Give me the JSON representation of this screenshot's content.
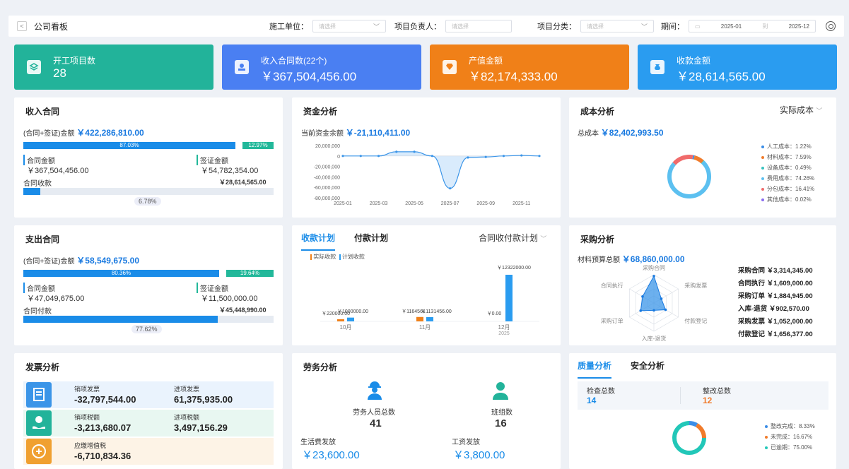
{
  "header": {
    "title": "公司看板",
    "back": "<",
    "filters": [
      {
        "label": "施工单位：",
        "placeholder": "请选择"
      },
      {
        "label": "项目负责人：",
        "placeholder": "请选择"
      },
      {
        "label": "项目分类：",
        "placeholder": "请选择"
      }
    ],
    "period": {
      "label": "期间：",
      "from": "2025-01",
      "sep": "到",
      "to": "2025-12"
    }
  },
  "kpis": [
    {
      "label": "开工项目数",
      "value": "28",
      "color": "#22b39a"
    },
    {
      "label": "收入合同数(22个)",
      "value": "￥367,504,456.00",
      "color": "#4a7ff2"
    },
    {
      "label": "产值金额",
      "value": "￥82,174,333.00",
      "color": "#f08018"
    },
    {
      "label": "收款金额",
      "value": "￥28,614,565.00",
      "color": "#2a9cf0"
    }
  ],
  "income": {
    "title": "收入合同",
    "total_label": "(合同+签证)金额",
    "total": "￥422,286,810.00",
    "bar_pct_a": "87.03%",
    "bar_pct_b": "12.97%",
    "frac_a": 0.8703,
    "contract_label": "合同金额",
    "contract": "￥367,504,456.00",
    "visa_label": "签证金额",
    "visa": "￥54,782,354.00",
    "recv_label": "合同收款",
    "recv": "￥28,614,565.00",
    "recv_pct": "6.78%",
    "recv_frac": 0.0678
  },
  "expense": {
    "title": "支出合同",
    "total_label": "(合同+签证)金额",
    "total": "￥58,549,675.00",
    "bar_pct_a": "80.36%",
    "bar_pct_b": "19.64%",
    "frac_a": 0.8036,
    "contract_label": "合同金额",
    "contract": "￥47,049,675.00",
    "visa_label": "签证金额",
    "visa": "￥11,500,000.00",
    "pay_label": "合同付款",
    "pay": "￥45,448,990.00",
    "pay_pct": "77.62%",
    "pay_frac": 0.7762
  },
  "funds": {
    "title": "资金分析",
    "balance_label": "当前资金余额",
    "balance": "￥-21,110,411.00"
  },
  "chart_data": [
    {
      "type": "area",
      "title": "资金分析",
      "x": [
        "2025-01",
        "2025-02",
        "2025-03",
        "2025-04",
        "2025-05",
        "2025-06",
        "2025-07",
        "2025-08",
        "2025-09",
        "2025-10",
        "2025-11",
        "2025-12"
      ],
      "ticks_x": [
        "2025-01",
        "2025-03",
        "2025-05",
        "2025-07",
        "2025-09",
        "2025-11"
      ],
      "values": [
        0,
        0,
        0,
        8000000,
        8000000,
        0,
        -62000000,
        -3000000,
        -2000000,
        0,
        1000000,
        0
      ],
      "ylim": [
        -80000000,
        20000000
      ],
      "ticks_y": [
        "20,000,000",
        "0",
        "-20,000,000",
        "-40,000,000",
        "-60,000,000",
        "-80,000,000"
      ]
    },
    {
      "type": "bar",
      "title": "收款计划",
      "categories": [
        "10月",
        "11月",
        "12月"
      ],
      "cat_sub": [
        "",
        "",
        "2025"
      ],
      "series": [
        {
          "name": "实际收款",
          "values": [
            220000,
            1164561,
            0
          ]
        },
        {
          "name": "计划收款",
          "values": [
            1000000,
            1131456,
            12322000
          ]
        }
      ],
      "labels": [
        "￥220000.00",
        "￥1000000.00",
        "￥1164561",
        "￥1131456.00",
        "￥0.00",
        "￥12322000.00"
      ]
    },
    {
      "type": "pie",
      "title": "成本分析",
      "series": [
        {
          "name": "人工成本",
          "value": 1.22,
          "color": "#3b8de6"
        },
        {
          "name": "材料成本",
          "value": 7.59,
          "color": "#f07b2b"
        },
        {
          "name": "设备成本",
          "value": 0.49,
          "color": "#39c3c0"
        },
        {
          "name": "费用成本",
          "value": 74.26,
          "color": "#5cc0f0"
        },
        {
          "name": "分包成本",
          "value": 16.41,
          "color": "#f06b6b"
        },
        {
          "name": "其他成本",
          "value": 0.02,
          "color": "#8b6df0"
        }
      ]
    },
    {
      "type": "radar",
      "title": "采购分析",
      "axes": [
        "采购合同",
        "采购发票",
        "付款登记",
        "入库-退货",
        "采购订单",
        "合同执行"
      ],
      "values": [
        3314345,
        1052000,
        1656377,
        902570,
        1884945,
        1609000
      ]
    },
    {
      "type": "pie",
      "title": "质量分析",
      "series": [
        {
          "name": "整改完成",
          "value": 8.33,
          "color": "#3b8de6"
        },
        {
          "name": "未完成",
          "value": 16.67,
          "color": "#f07b2b"
        },
        {
          "name": "已逾期",
          "value": 75.0,
          "color": "#22c7b8"
        }
      ]
    }
  ],
  "cost": {
    "title": "成本分析",
    "dropdown": "实际成本",
    "total_label": "总成本",
    "total": "￥82,402,993.50",
    "legend": [
      "人工成本：1.22%",
      "材料成本：7.59%",
      "设备成本：0.49%",
      "费用成本：74.26%",
      "分包成本：16.41%",
      "其他成本：0.02%"
    ]
  },
  "plan": {
    "tab1": "收款计划",
    "tab2": "付款计划",
    "dropdown": "合同收付款计划",
    "leg1": "实际收款",
    "leg2": "计划收款"
  },
  "purchase": {
    "title": "采购分析",
    "budget_label": "材料预算总额",
    "budget": "￥68,860,000.00",
    "items": [
      {
        "label": "采购合同",
        "value": "￥3,314,345.00"
      },
      {
        "label": "合同执行",
        "value": "￥1,609,000.00"
      },
      {
        "label": "采购订单",
        "value": "￥1,884,945.00"
      },
      {
        "label": "入库-退货",
        "value": "￥902,570.00"
      },
      {
        "label": "采购发票",
        "value": "￥1,052,000.00"
      },
      {
        "label": "付款登记",
        "value": "￥1,656,377.00"
      }
    ]
  },
  "invoice": {
    "title": "发票分析",
    "rows": [
      {
        "l1": "销项发票",
        "v1": "-32,797,544.00",
        "l2": "进项发票",
        "v2": "61,375,935.00",
        "bg": "#eaf3fd",
        "ic": "#3b95e8"
      },
      {
        "l1": "销项税额",
        "v1": "-3,213,680.07",
        "l2": "进项税额",
        "v2": "3,497,156.29",
        "bg": "#e8f7f1",
        "ic": "#22b39a"
      },
      {
        "l1": "应缴增值税",
        "v1": "-6,710,834.36",
        "l2": "",
        "v2": "",
        "bg": "#fdf3e6",
        "ic": "#f0a030"
      }
    ]
  },
  "labor": {
    "title": "劳务分析",
    "people_label": "劳务人员总数",
    "people": "41",
    "team_label": "班组数",
    "team": "16",
    "living_label": "生活费发放",
    "living": "￥23,600.00",
    "wage_label": "工资发放",
    "wage": "￥3,800.00"
  },
  "quality": {
    "tab1": "质量分析",
    "tab2": "安全分析",
    "check_label": "检查总数",
    "check": "14",
    "fix_label": "整改总数",
    "fix": "12",
    "legend": [
      "整改完成：8.33%",
      "未完成：16.67%",
      "已逾期：75.00%"
    ]
  }
}
